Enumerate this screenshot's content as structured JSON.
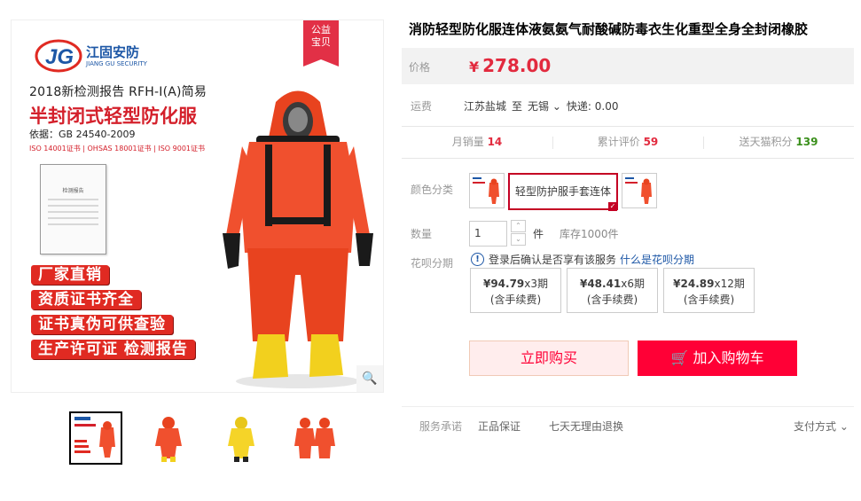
{
  "product": {
    "title": "消防轻型防化服连体液氨氨气耐酸碱防毒衣生化重型全身全封闭橡胶"
  },
  "gallery": {
    "badge": [
      "公益",
      "宝贝"
    ],
    "logo_name": "江固安防",
    "logo_en": "JIANG GU SECURITY",
    "line1": "2018新检测报告 RFH-Ⅰ(A)简易",
    "line2": "半封闭式轻型防化服",
    "line3": "依据：GB 24540-2009",
    "line4": "ISO 14001证书 | OHSAS 18001证书 | ISO 9001证书",
    "cert_title": "检测报告",
    "tags": [
      "厂家直销",
      "资质证书齐全",
      "证书真伪可供查验",
      "生产许可证 检测报告"
    ],
    "zoom_icon": "search-icon",
    "thumbnail_count": 4
  },
  "price": {
    "label": "价格",
    "currency": "¥",
    "value": "278.00"
  },
  "shipping": {
    "label": "运费",
    "from": "江苏盐城",
    "to_prefix": "至",
    "to": "无锡",
    "express": "快递: 0.00"
  },
  "stats": [
    {
      "label": "月销量",
      "value": "14"
    },
    {
      "label": "累计评价",
      "value": "59"
    },
    {
      "label": "送天猫积分",
      "value": "139"
    }
  ],
  "color": {
    "label": "颜色分类",
    "selected": "轻型防护服手套连体"
  },
  "quantity": {
    "label": "数量",
    "value": "1",
    "unit": "件",
    "stock": "库存1000件"
  },
  "huabei": {
    "label": "花呗分期",
    "note": "登录后确认是否享有该服务",
    "link": "什么是花呗分期",
    "options": [
      {
        "amount": "¥94.79",
        "periods": "x3期",
        "fee": "(含手续费)"
      },
      {
        "amount": "¥48.41",
        "periods": "x6期",
        "fee": "(含手续费)"
      },
      {
        "amount": "¥24.89",
        "periods": "x12期",
        "fee": "(含手续费)"
      }
    ]
  },
  "actions": {
    "buy": "立即购买",
    "cart": "加入购物车"
  },
  "service": {
    "label": "服务承诺",
    "items": [
      "正品保证",
      "七天无理由退换"
    ],
    "payment": "支付方式"
  },
  "colors": {
    "accent": "#ff0036",
    "price": "#e22a3e",
    "suit_orange": "#f0502e",
    "suit_yellow": "#f5d428"
  }
}
